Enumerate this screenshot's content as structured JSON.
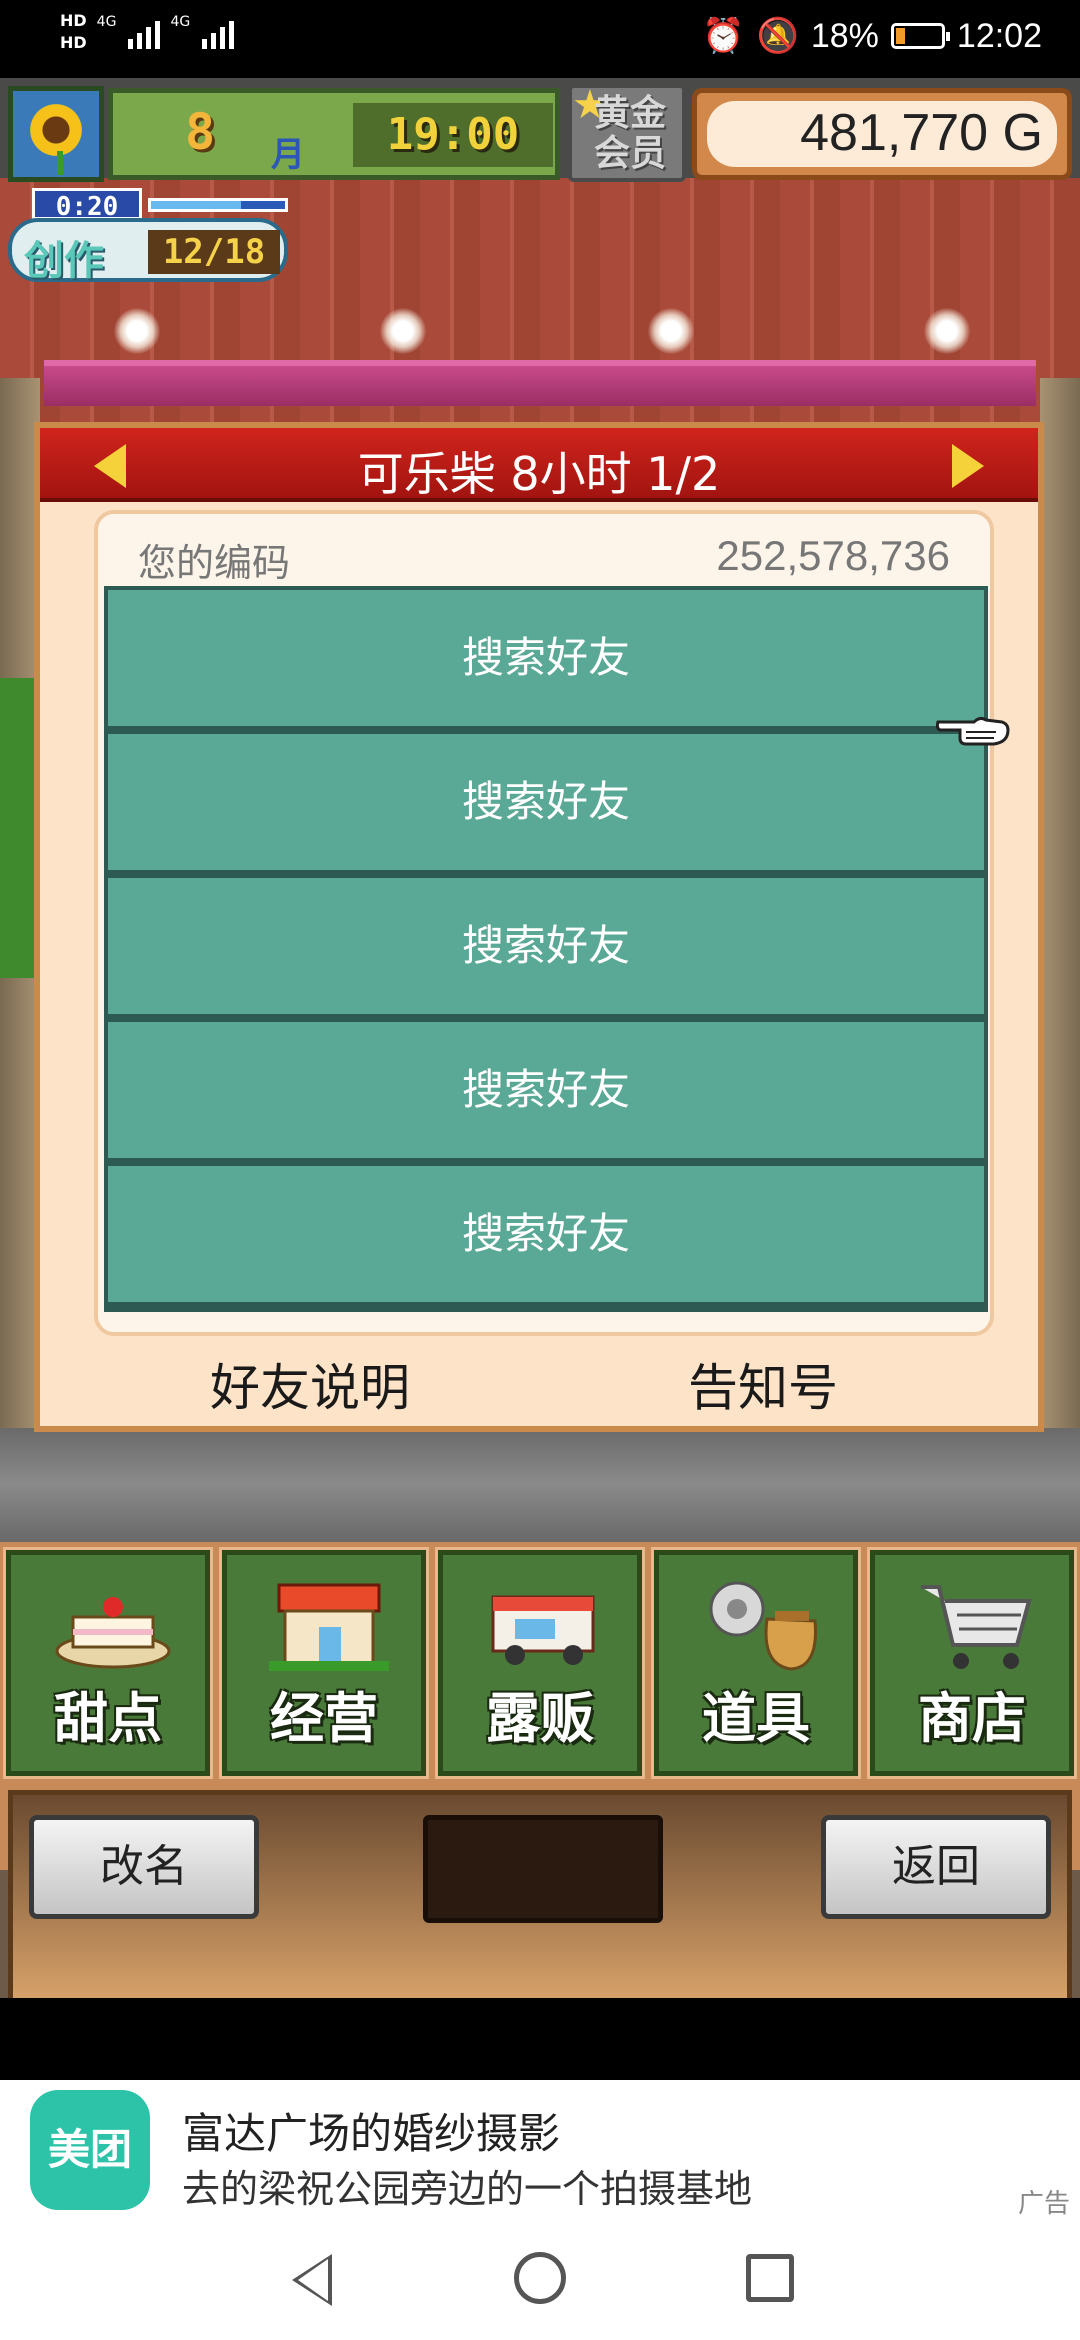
{
  "status_bar": {
    "hd1": "HD",
    "hd2": "HD",
    "net1": "4G",
    "net2": "4G",
    "battery_percent": "18%",
    "battery_level": 0.18,
    "time": "12:02"
  },
  "hud": {
    "month_number": "8",
    "month_unit": "月",
    "clock": "19:00",
    "gold_member_label": "黄金会员",
    "money": "481,770 G",
    "create_timer": "0:20",
    "create_label": "创作",
    "create_count": "12/18",
    "create_progress": 0.67
  },
  "panel": {
    "title": "可乐柴  8小时 1/2",
    "code_label": "您的编码",
    "code_value": "252,578,736",
    "friend_slots": [
      "搜索好友",
      "搜索好友",
      "搜索好友",
      "搜索好友",
      "搜索好友"
    ],
    "friend_help": "好友说明",
    "notice_number": "告知号"
  },
  "menu": {
    "items": [
      {
        "label": "甜点",
        "icon": "cake-icon"
      },
      {
        "label": "经营",
        "icon": "shop-building-icon"
      },
      {
        "label": "露贩",
        "icon": "food-truck-icon"
      },
      {
        "label": "道具",
        "icon": "items-bag-icon"
      },
      {
        "label": "商店",
        "icon": "shopping-cart-icon"
      }
    ],
    "rename_label": "改名",
    "back_label": "返回"
  },
  "ad": {
    "logo_text": "美团",
    "title": "富达广场的婚纱摄影",
    "subtitle": "去的梁祝公园旁边的一个拍摄基地",
    "tag": "广告"
  },
  "colors": {
    "header_red": "#c0201a",
    "slot_teal": "#5aa896",
    "panel_cream": "#fde4c8",
    "meituan_green": "#2cc3a8"
  }
}
